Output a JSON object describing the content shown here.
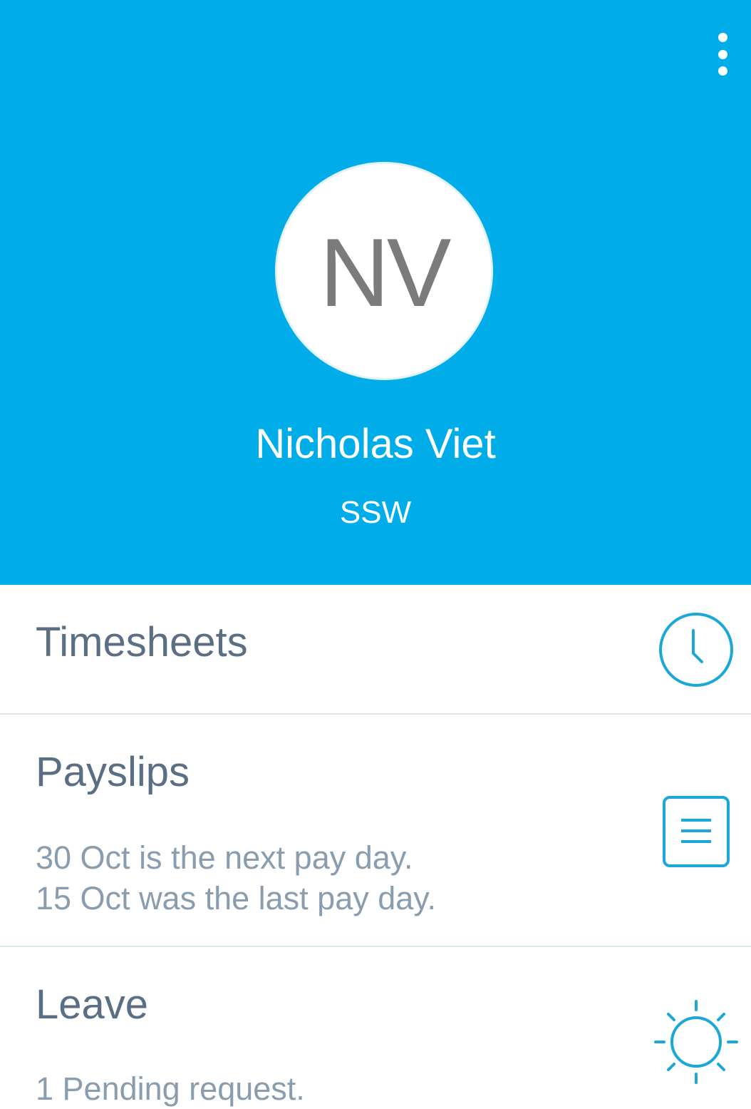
{
  "header": {
    "background_color": "#00ADE8",
    "menu_icon": "more-vert-icon",
    "avatar_initials": "NV",
    "user_name": "Nicholas Viet",
    "company": "SSW"
  },
  "menu": {
    "timesheets": {
      "title": "Timesheets",
      "icon": "clock-icon"
    },
    "payslips": {
      "title": "Payslips",
      "next_pay": "30 Oct is the next pay day.",
      "last_pay": "15 Oct was the last pay day.",
      "icon": "document-icon"
    },
    "leave": {
      "title": "Leave",
      "status": "1 Pending request.",
      "icon": "sun-icon"
    }
  },
  "colors": {
    "accent": "#00ADE8",
    "title_text": "#5A6E84",
    "subtitle_text": "#8A9DAE",
    "divider": "#DCE8EE"
  }
}
